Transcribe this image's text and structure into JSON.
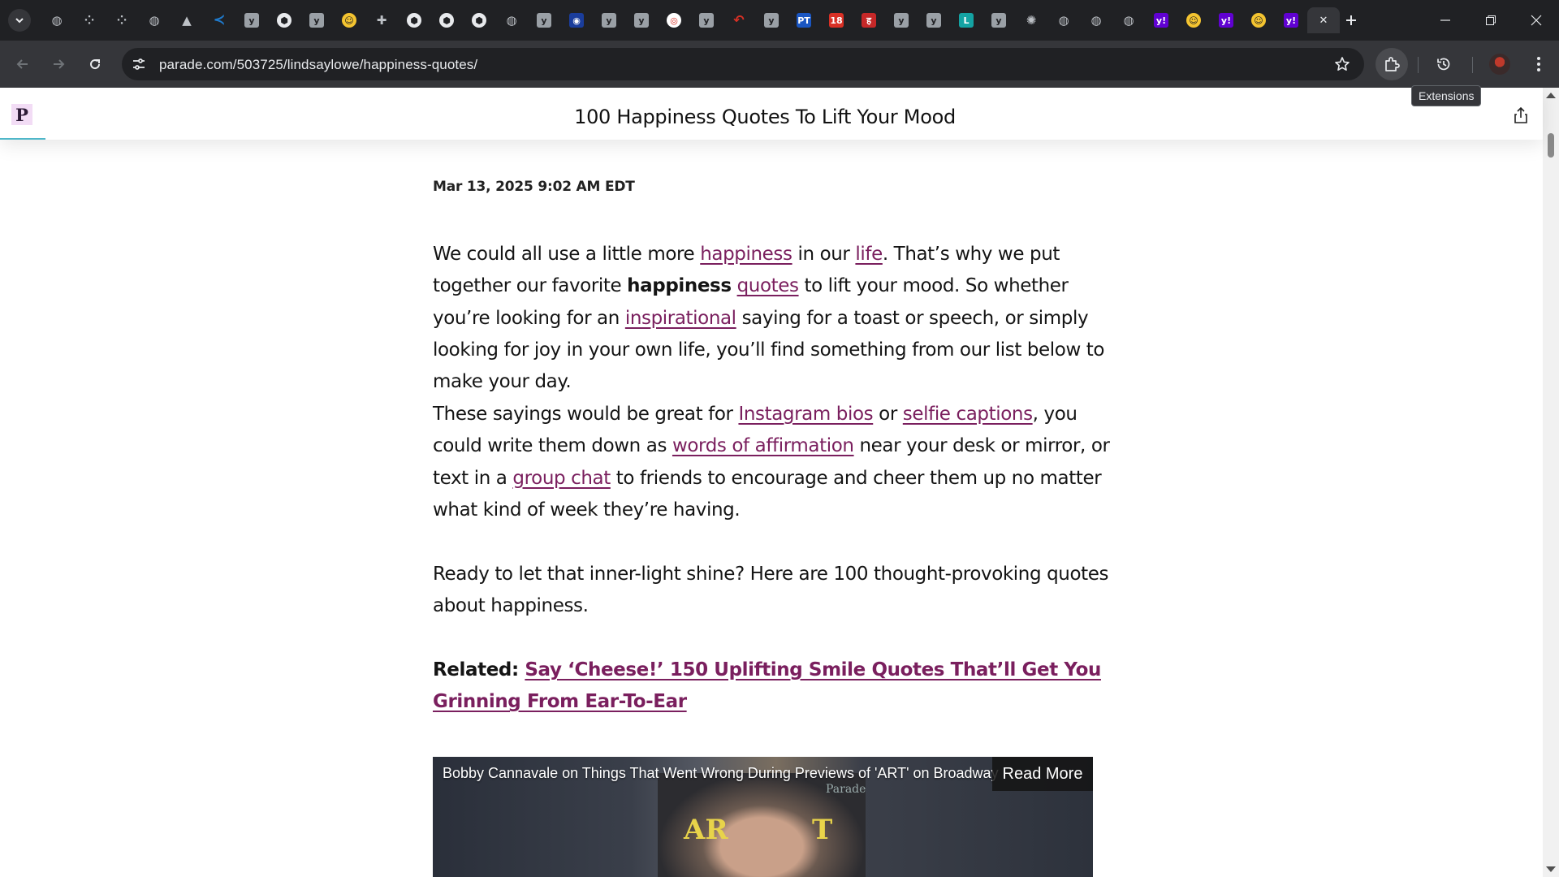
{
  "tabs": [
    {
      "icon": "globe-icon",
      "color": "#5f6368",
      "glyph": "◍"
    },
    {
      "icon": "grid-icon",
      "color": "#5f6368",
      "glyph": "⁘"
    },
    {
      "icon": "grid-icon",
      "color": "#5f6368",
      "glyph": "⁘"
    },
    {
      "icon": "globe-icon",
      "color": "#5f6368",
      "glyph": "◍"
    },
    {
      "icon": "drive-icon",
      "color": "#5f6368",
      "glyph": "▲"
    },
    {
      "icon": "vscode-icon",
      "color": "#1f7acc",
      "glyph": "≺"
    },
    {
      "icon": "y-icon",
      "color": "#9aa0a6",
      "glyph": "y"
    },
    {
      "icon": "cube-icon",
      "color": "#202124",
      "glyph": "⬢"
    },
    {
      "icon": "y-icon",
      "color": "#9aa0a6",
      "glyph": "y"
    },
    {
      "icon": "hugging-face-icon",
      "color": "#f4c430",
      "glyph": "☺"
    },
    {
      "icon": "puzzle-icon",
      "color": "#5f6368",
      "glyph": "✚"
    },
    {
      "icon": "cube-icon",
      "color": "#202124",
      "glyph": "⬢"
    },
    {
      "icon": "cube-icon",
      "color": "#202124",
      "glyph": "⬢"
    },
    {
      "icon": "cube-icon",
      "color": "#202124",
      "glyph": "⬢"
    },
    {
      "icon": "globe-icon",
      "color": "#5f6368",
      "glyph": "◍"
    },
    {
      "icon": "y-icon",
      "color": "#9aa0a6",
      "glyph": "y"
    },
    {
      "icon": "badge-icon",
      "color": "#1a3d9c",
      "glyph": "◉"
    },
    {
      "icon": "y-icon",
      "color": "#9aa0a6",
      "glyph": "y"
    },
    {
      "icon": "y-icon",
      "color": "#9aa0a6",
      "glyph": "y"
    },
    {
      "icon": "mw-icon",
      "color": "#d93025",
      "glyph": "◎"
    },
    {
      "icon": "y-icon",
      "color": "#9aa0a6",
      "glyph": "y"
    },
    {
      "icon": "reply-icon",
      "color": "#d93025",
      "glyph": "↶"
    },
    {
      "icon": "y-icon",
      "color": "#9aa0a6",
      "glyph": "y"
    },
    {
      "icon": "pt-icon",
      "color": "#1a56c2",
      "glyph": "PT"
    },
    {
      "icon": "news18-icon",
      "color": "#d93025",
      "glyph": "18"
    },
    {
      "icon": "hindi-news-icon",
      "color": "#c62828",
      "glyph": "ह"
    },
    {
      "icon": "y-icon",
      "color": "#9aa0a6",
      "glyph": "y"
    },
    {
      "icon": "y-icon",
      "color": "#9aa0a6",
      "glyph": "y"
    },
    {
      "icon": "l-icon",
      "color": "#14a3a3",
      "glyph": "L"
    },
    {
      "icon": "y-icon",
      "color": "#9aa0a6",
      "glyph": "y"
    },
    {
      "icon": "openai-icon",
      "color": "#5f6368",
      "glyph": "✺"
    },
    {
      "icon": "globe-icon",
      "color": "#5f6368",
      "glyph": "◍"
    },
    {
      "icon": "globe-icon",
      "color": "#5f6368",
      "glyph": "◍"
    },
    {
      "icon": "globe-icon",
      "color": "#5f6368",
      "glyph": "◍"
    },
    {
      "icon": "yahoo-icon",
      "color": "#6001d2",
      "glyph": "y!"
    },
    {
      "icon": "hugging-face-icon",
      "color": "#f4c430",
      "glyph": "☺"
    },
    {
      "icon": "yahoo-icon",
      "color": "#6001d2",
      "glyph": "y!"
    },
    {
      "icon": "hugging-face-icon",
      "color": "#f4c430",
      "glyph": "☺"
    },
    {
      "icon": "yahoo-icon",
      "color": "#6001d2",
      "glyph": "y!"
    },
    {
      "icon": "close-icon",
      "color": "#35363a",
      "glyph": "✕",
      "active": true
    }
  ],
  "omnibox": {
    "url": "parade.com/503725/lindsaylowe/happiness-quotes/"
  },
  "tooltip": "Extensions",
  "header": {
    "logo": "P",
    "title": "100 Happiness Quotes To Lift Your Mood"
  },
  "article": {
    "dateline": "Mar 13, 2025 9:02 AM EDT",
    "p1": {
      "t1": "We could all use a little more ",
      "l1": "happiness",
      "t2": " in our ",
      "l2": "life",
      "t3": ". That’s why we put together our favorite ",
      "b1": "happiness",
      "t4": " ",
      "l3": "quotes",
      "t5": " to lift your mood. So whether you’re looking for an ",
      "l4": "inspirational",
      "t6": " saying for a toast or speech, or simply looking for joy in your own life, you’ll find something from our list below to make your day."
    },
    "p2": {
      "t1": "These sayings would be great for ",
      "l1": "Instagram bios",
      "t2": " or ",
      "l2": "selfie captions",
      "t3": ", you could write them down as ",
      "l3": "words of affirmation",
      "t4": " near your desk or mirror, or text in a ",
      "l4": "group chat",
      "t5": " to friends to encourage and cheer them up no matter what kind of week they’re having."
    },
    "p3": "Ready to let that inner-light shine? Here are 100 thought-provoking quotes about happiness.",
    "related": {
      "label": "Related: ",
      "link": "Say ‘Cheese!’ 150 Uplifting Smile Quotes That’ll Get You Grinning From Ear-To-Ear"
    }
  },
  "video": {
    "title": "Bobby Cannavale on Things That Went Wrong During Previews of 'ART' on Broadway",
    "read_more": "Read More",
    "brand": "Parade",
    "backdrop_left": "AR",
    "backdrop_right": "T"
  },
  "colors": {
    "link": "#7a1f5e",
    "chrome_dark": "#202124",
    "chrome_toolbar": "#35363a",
    "accent_bar": "#4fb7c9"
  }
}
